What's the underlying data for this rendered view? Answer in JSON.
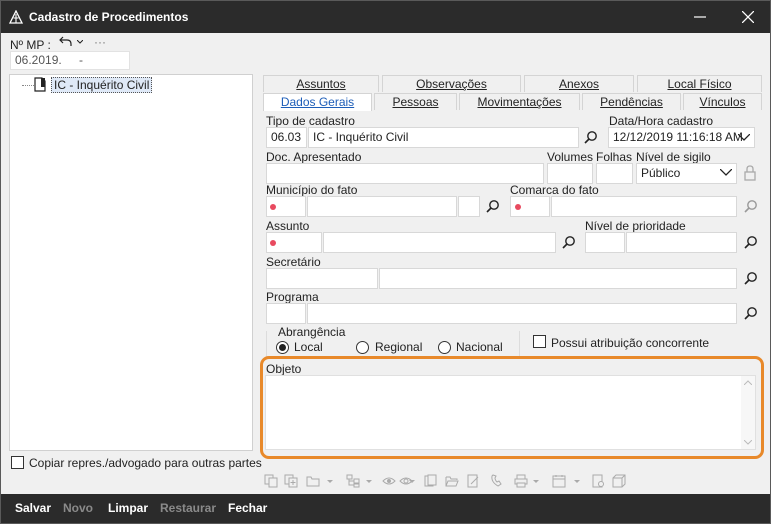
{
  "window": {
    "title": "Cadastro de Procedimentos",
    "minimize": "—",
    "close": "✕"
  },
  "mp": {
    "label": "Nº MP :",
    "value": "06.2019.",
    "suffix": "-",
    "more": "···"
  },
  "tree": {
    "root_label": "IC - Inquérito Civil"
  },
  "copy_checkbox": {
    "label": "Copiar repres./advogado para outras partes",
    "checked": false
  },
  "tabs": {
    "row1": [
      "Assuntos",
      "Observações",
      "Anexos",
      "Local Físico"
    ],
    "row2": [
      "Dados Gerais",
      "Pessoas",
      "Movimentações",
      "Pendências",
      "Vínculos"
    ],
    "active": "Dados Gerais"
  },
  "form": {
    "tipo_cadastro_label": "Tipo de cadastro",
    "tipo_cadastro_code": "06.03",
    "tipo_cadastro_value": "IC - Inquérito Civil",
    "data_hora_label": "Data/Hora cadastro",
    "data_hora_value": "12/12/2019 11:16:18 AM",
    "doc_apresentado_label": "Doc. Apresentado",
    "volumes_label": "Volumes",
    "folhas_label": "Folhas",
    "nivel_sigilo_label": "Nível de sigilo",
    "nivel_sigilo_value": "Público",
    "municipio_label": "Município do fato",
    "comarca_label": "Comarca do fato",
    "assunto_label": "Assunto",
    "nivel_prioridade_label": "Nível de prioridade",
    "secretario_label": "Secretário",
    "programa_label": "Programa",
    "abrangencia_label": "Abrangência",
    "abrangencia_options": [
      "Local",
      "Regional",
      "Nacional"
    ],
    "abrangencia_selected": "Local",
    "atribuicao_label": "Possui atribuição concorrente",
    "objeto_label": "Objeto"
  },
  "footer": {
    "buttons": [
      "Salvar",
      "Novo",
      "Limpar",
      "Restaurar",
      "Fechar"
    ],
    "disabled": [
      "Novo",
      "Restaurar"
    ]
  },
  "colors": {
    "title_bar": "#2b2b2b",
    "highlight_border": "#e8892a",
    "required_dot": "#e84a5f",
    "active_tab_text": "#1e5eb8"
  }
}
